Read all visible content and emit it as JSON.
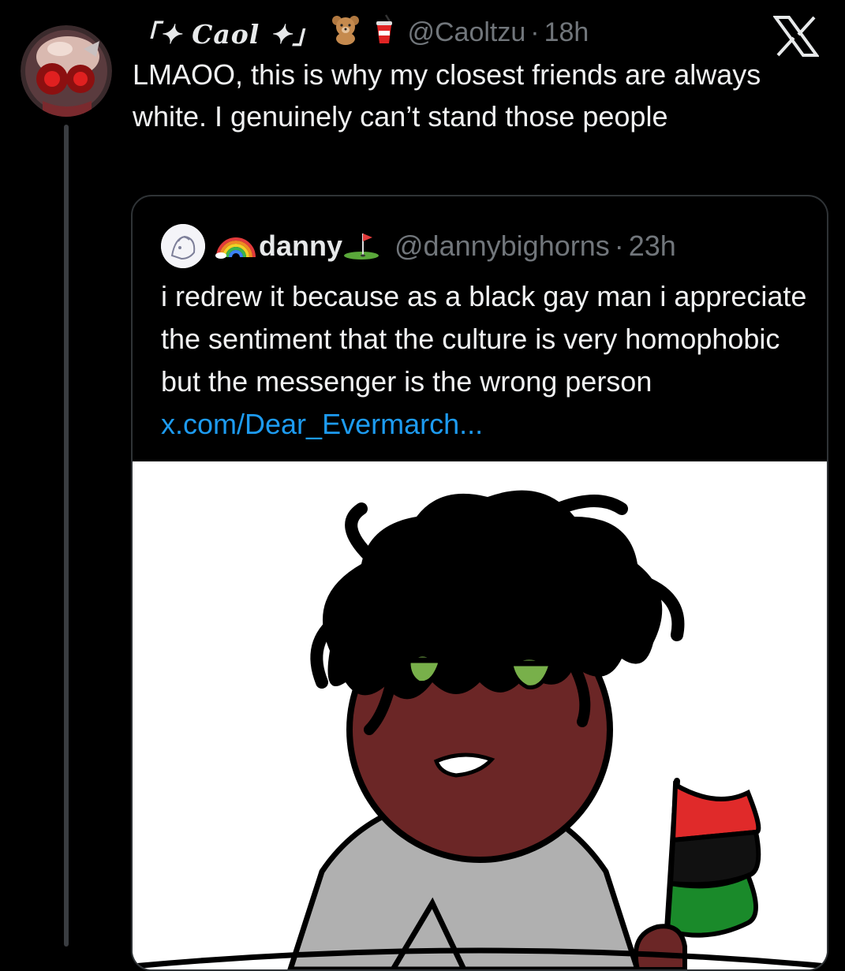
{
  "tweet": {
    "display_name": "「✦ Caol ✦」",
    "name_emojis": [
      "teddy-bear-emoji",
      "cup-with-straw-emoji"
    ],
    "handle": "@Caoltzu",
    "separator": "·",
    "time": "18h",
    "text": "LMAOO, this is why my closest friends are always white. I genuinely can’t stand those people"
  },
  "quote": {
    "name_prefix_emoji": "rainbow-emoji",
    "display_name": "danny",
    "name_suffix_emoji": "golf-flag-emoji",
    "handle": "@dannybighorns",
    "separator": "·",
    "time": "23h",
    "text": "i redrew it because as a black gay man i appreciate the sentiment that the culture is very homophobic but the messenger is the wrong person ",
    "link": "x.com/Dear_Evermarch..."
  },
  "icons": {
    "platform_logo": "x-logo-icon"
  },
  "colors": {
    "background": "#000000",
    "text": "#e7e9ea",
    "muted": "#71767b",
    "link": "#1d9bf0",
    "border": "#2f3336"
  }
}
